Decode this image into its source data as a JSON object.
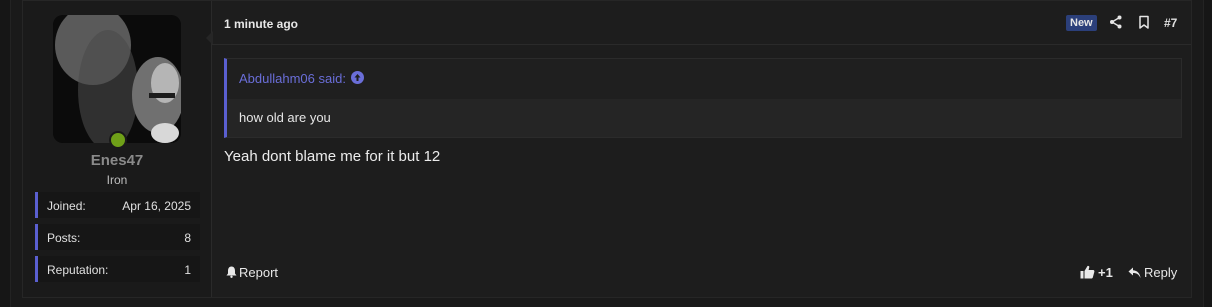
{
  "user": {
    "name": "Enes47",
    "title": "Iron",
    "online_color": "#6fa018",
    "stats": [
      {
        "label": "Joined:",
        "value": "Apr 16, 2025"
      },
      {
        "label": "Posts:",
        "value": "8"
      },
      {
        "label": "Reputation:",
        "value": "1"
      }
    ]
  },
  "post": {
    "timestamp": "1 minute ago",
    "badge": "New",
    "number": "#7",
    "quote": {
      "author_line": "Abdullahm06 said:",
      "text": "how old are you"
    },
    "message": "Yeah dont blame me for it but 12",
    "footer": {
      "report_label": "Report",
      "likes_label": "+1",
      "reply_label": "Reply"
    }
  },
  "colors": {
    "accent": "#5a5fd0",
    "quote_link": "#6a6ed8",
    "badge_bg": "#2b3f7a"
  }
}
